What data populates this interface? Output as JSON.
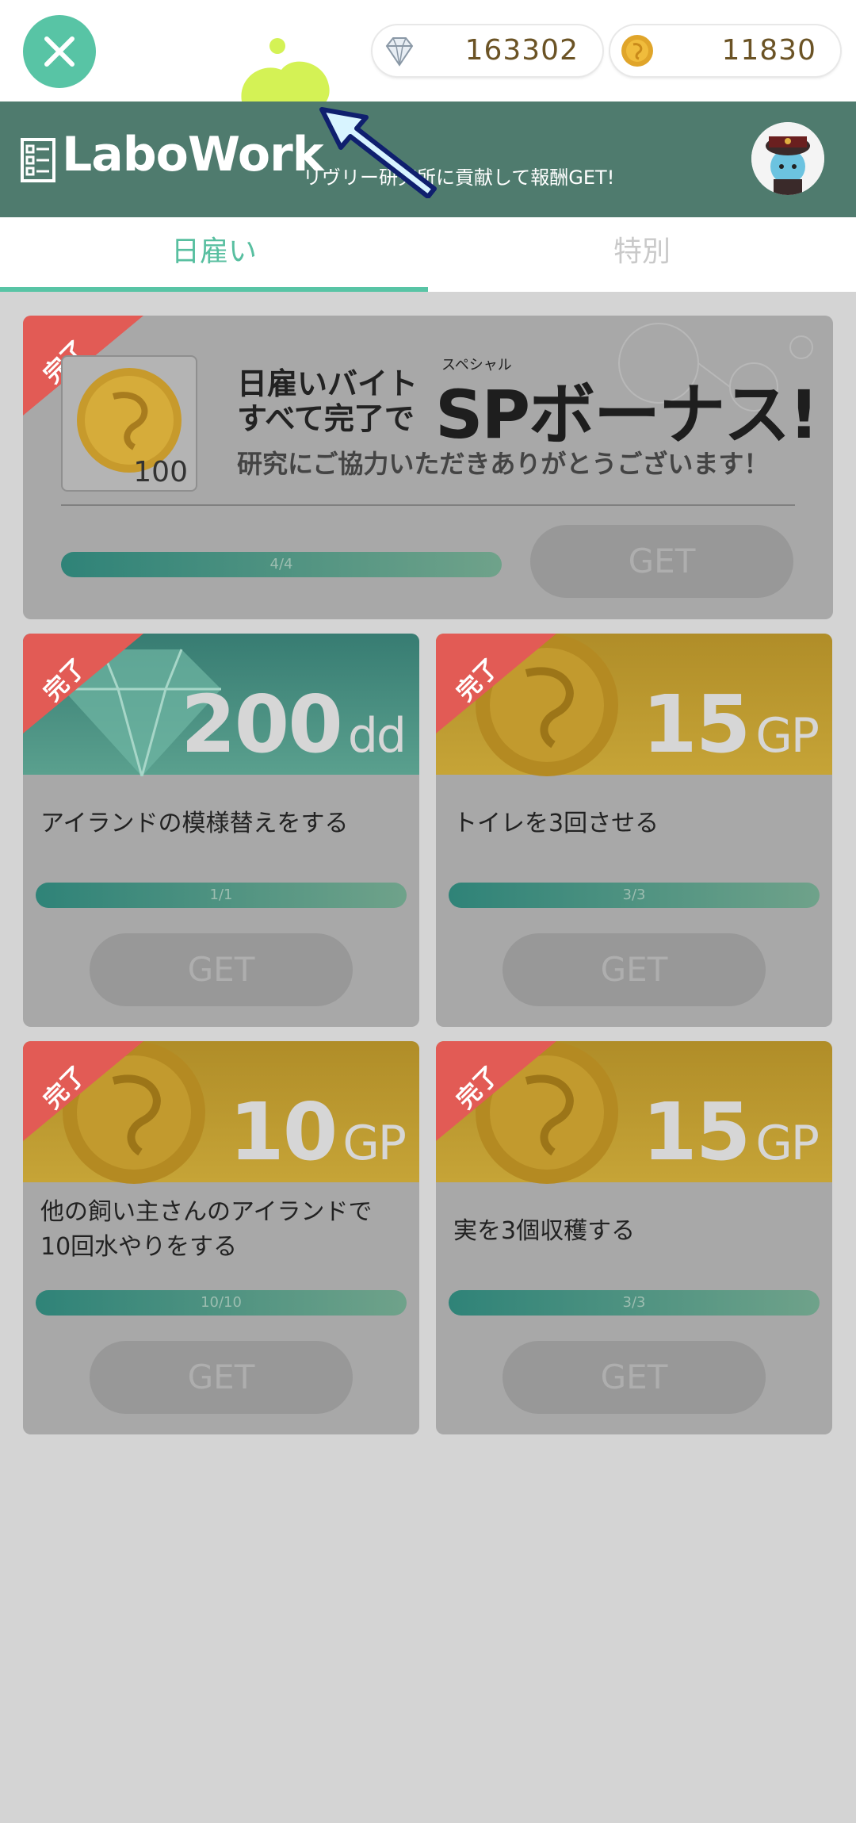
{
  "currency": {
    "diamonds": "163302",
    "coins": "11830"
  },
  "header": {
    "logo": "LaboWork",
    "subtitle": "リヴリー研究所に貢献して報酬GET!"
  },
  "tabs": [
    {
      "label": "日雇い",
      "active": true
    },
    {
      "label": "特別",
      "active": false
    }
  ],
  "bonus_card": {
    "badge": "完了",
    "coin_qty": "100",
    "line1": "日雇いバイト",
    "line2": "すべて完了で",
    "ruby": "スペシャル",
    "big": "SPボーナス!",
    "thanks": "研究にご協力いただきありがとうございます！",
    "progress": "4/4",
    "button": "GET"
  },
  "tasks": [
    {
      "badge": "完了",
      "amount": "200",
      "unit": "dd",
      "text": "アイランドの模様替えをする",
      "progress": "1/1",
      "button": "GET"
    },
    {
      "badge": "完了",
      "amount": "15",
      "unit": "GP",
      "text": "トイレを3回させる",
      "progress": "3/3",
      "button": "GET"
    },
    {
      "badge": "完了",
      "amount": "10",
      "unit": "GP",
      "text_line1": "他の飼い主さんのアイランドで",
      "text_line2": "10回水やりをする",
      "progress": "10/10",
      "button": "GET"
    },
    {
      "badge": "完了",
      "amount": "15",
      "unit": "GP",
      "text": "実を3個収穫する",
      "progress": "3/3",
      "button": "GET"
    }
  ]
}
